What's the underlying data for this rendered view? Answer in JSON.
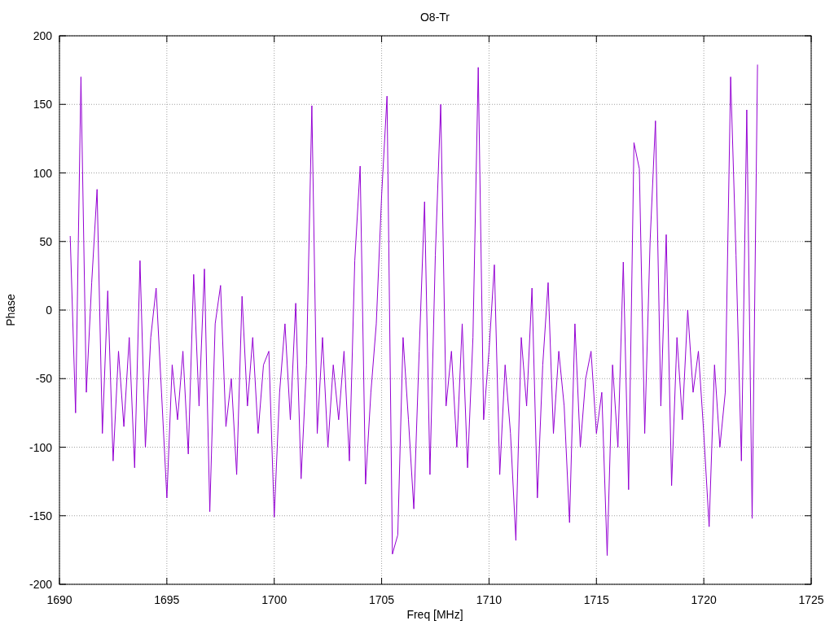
{
  "chart_data": {
    "type": "line",
    "title": "O8-Tr",
    "grid": true,
    "xlabel": "Freq [MHz]",
    "ylabel": "Phase",
    "xlim": [
      1690,
      1725
    ],
    "ylim": [
      -200,
      200
    ],
    "xticks": [
      1690,
      1695,
      1700,
      1705,
      1710,
      1715,
      1720,
      1725
    ],
    "yticks": [
      -200,
      -150,
      -100,
      -50,
      0,
      50,
      100,
      150,
      200
    ],
    "x": [
      1690.5,
      1690.75,
      1691,
      1691.25,
      1691.5,
      1691.75,
      1692,
      1692.25,
      1692.5,
      1692.75,
      1693,
      1693.25,
      1693.5,
      1693.75,
      1694,
      1694.25,
      1694.5,
      1694.75,
      1695,
      1695.25,
      1695.5,
      1695.75,
      1696,
      1696.25,
      1696.5,
      1696.75,
      1697,
      1697.25,
      1697.5,
      1697.75,
      1698,
      1698.25,
      1698.5,
      1698.75,
      1699,
      1699.25,
      1699.5,
      1699.75,
      1700,
      1700.25,
      1700.5,
      1700.75,
      1701,
      1701.25,
      1701.5,
      1701.75,
      1702,
      1702.25,
      1702.5,
      1702.75,
      1703,
      1703.25,
      1703.5,
      1703.75,
      1704,
      1704.25,
      1704.5,
      1704.75,
      1705,
      1705.25,
      1705.5,
      1705.75,
      1706,
      1706.25,
      1706.5,
      1706.75,
      1707,
      1707.25,
      1707.5,
      1707.75,
      1708,
      1708.25,
      1708.5,
      1708.75,
      1709,
      1709.25,
      1709.5,
      1709.75,
      1710,
      1710.25,
      1710.5,
      1710.75,
      1711,
      1711.25,
      1711.5,
      1711.75,
      1712,
      1712.25,
      1712.5,
      1712.75,
      1713,
      1713.25,
      1713.5,
      1713.75,
      1714,
      1714.25,
      1714.5,
      1714.75,
      1715,
      1715.25,
      1715.5,
      1715.75,
      1716,
      1716.25,
      1716.5,
      1716.75,
      1717,
      1717.25,
      1717.5,
      1717.75,
      1718,
      1718.25,
      1718.5,
      1718.75,
      1719,
      1719.25,
      1719.5,
      1719.75,
      1720,
      1720.25,
      1720.5,
      1720.75,
      1721,
      1721.25,
      1721.5,
      1721.75,
      1722,
      1722.25,
      1722.5
    ],
    "series": [
      {
        "color": "#9400d3",
        "values": [
          54,
          -75,
          170,
          -60,
          20,
          88,
          -90,
          14,
          -110,
          -30,
          -85,
          -20,
          -115,
          36,
          -100,
          -20,
          16,
          -60,
          -137,
          -40,
          -80,
          -30,
          -105,
          26,
          -70,
          30,
          -147,
          -10,
          18,
          -85,
          -50,
          -120,
          10,
          -70,
          -20,
          -90,
          -40,
          -30,
          -151,
          -60,
          -10,
          -80,
          5,
          -123,
          -40,
          149,
          -90,
          -20,
          -100,
          -40,
          -80,
          -30,
          -110,
          36,
          105,
          -127,
          -60,
          -10,
          84,
          156,
          -178,
          -164,
          -20,
          -80,
          -145,
          -30,
          79,
          -120,
          40,
          150,
          -70,
          -30,
          -100,
          -10,
          -115,
          -20,
          177,
          -80,
          -30,
          33,
          -120,
          -40,
          -90,
          -168,
          -20,
          -70,
          16,
          -137,
          -40,
          20,
          -90,
          -30,
          -70,
          -155,
          -10,
          -100,
          -50,
          -30,
          -90,
          -60,
          -179,
          -40,
          -100,
          35,
          -131,
          122,
          103,
          -90,
          50,
          138,
          -70,
          55,
          -128,
          -20,
          -80,
          0,
          -60,
          -30,
          -90,
          -158,
          -40,
          -100,
          -60,
          170,
          40,
          -110,
          146,
          -152,
          179
        ]
      }
    ]
  }
}
